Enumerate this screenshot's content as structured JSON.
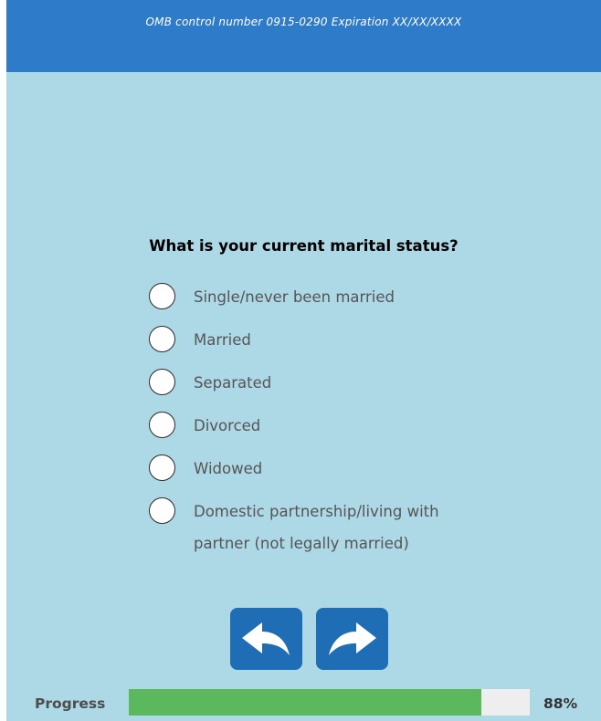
{
  "header": {
    "omb_text": "OMB control number 0915-0290 Expiration XX/XX/XXXX"
  },
  "question": {
    "text": "What is your current marital status?",
    "options": [
      {
        "label": "Single/never been married",
        "selected": false
      },
      {
        "label": "Married",
        "selected": false
      },
      {
        "label": "Separated",
        "selected": false
      },
      {
        "label": "Divorced",
        "selected": false
      },
      {
        "label": "Widowed",
        "selected": false
      },
      {
        "label": "Domestic partnership/living with partner (not legally married)",
        "selected": false
      }
    ]
  },
  "navigation": {
    "back_icon": "back-arrow-icon",
    "next_icon": "forward-arrow-icon"
  },
  "progress": {
    "label": "Progress",
    "percent_text": "88%",
    "fraction": 0.88
  },
  "colors": {
    "header_bg": "#2e7bc9",
    "page_bg": "#add8e6",
    "button_bg": "#1f6eb5",
    "progress_fill": "#5cb85c",
    "progress_track": "#eeeeee"
  }
}
